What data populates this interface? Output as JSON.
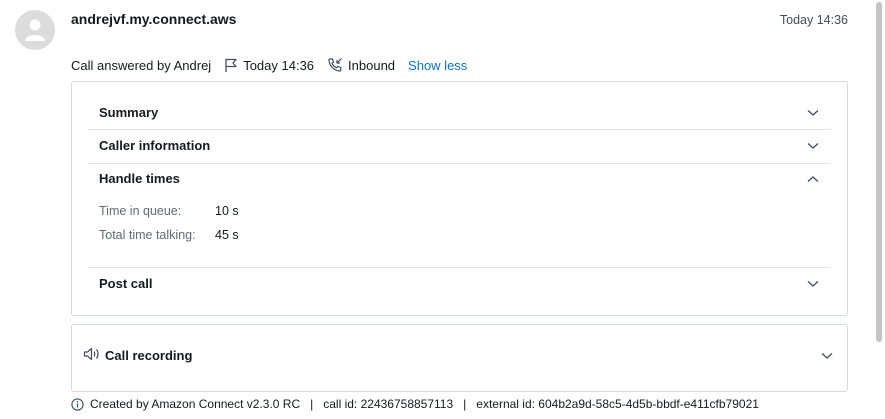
{
  "header": {
    "title": "andrejvf.my.connect.aws",
    "time": "Today 14:36"
  },
  "meta": {
    "answered_by": "Call answered by Andrej",
    "time": "Today 14:36",
    "direction": "Inbound",
    "show_less": "Show less"
  },
  "sections": {
    "summary": "Summary",
    "caller_info": "Caller information",
    "handle_times": {
      "title": "Handle times",
      "rows": [
        {
          "label": "Time in queue:",
          "value": "10 s"
        },
        {
          "label": "Total time talking:",
          "value": "45 s"
        }
      ]
    },
    "post_call": "Post call"
  },
  "recording": {
    "title": "Call recording"
  },
  "footer": {
    "created_by": "Created by Amazon Connect v2.3.0 RC",
    "call_id": "call id: 22436758857113",
    "external_id": "external id: 604b2a9d-58c5-4d5b-bbdf-e411cfb79021",
    "separator": "|"
  },
  "colors": {
    "link": "#0972d3",
    "border": "#d5dbdb",
    "text": "#16191f",
    "muted": "#5f6b7a"
  },
  "icons": [
    "user-avatar-icon",
    "flag-icon",
    "phone-inbound-icon",
    "chevron-down-icon",
    "chevron-up-icon",
    "speaker-icon",
    "info-icon"
  ]
}
